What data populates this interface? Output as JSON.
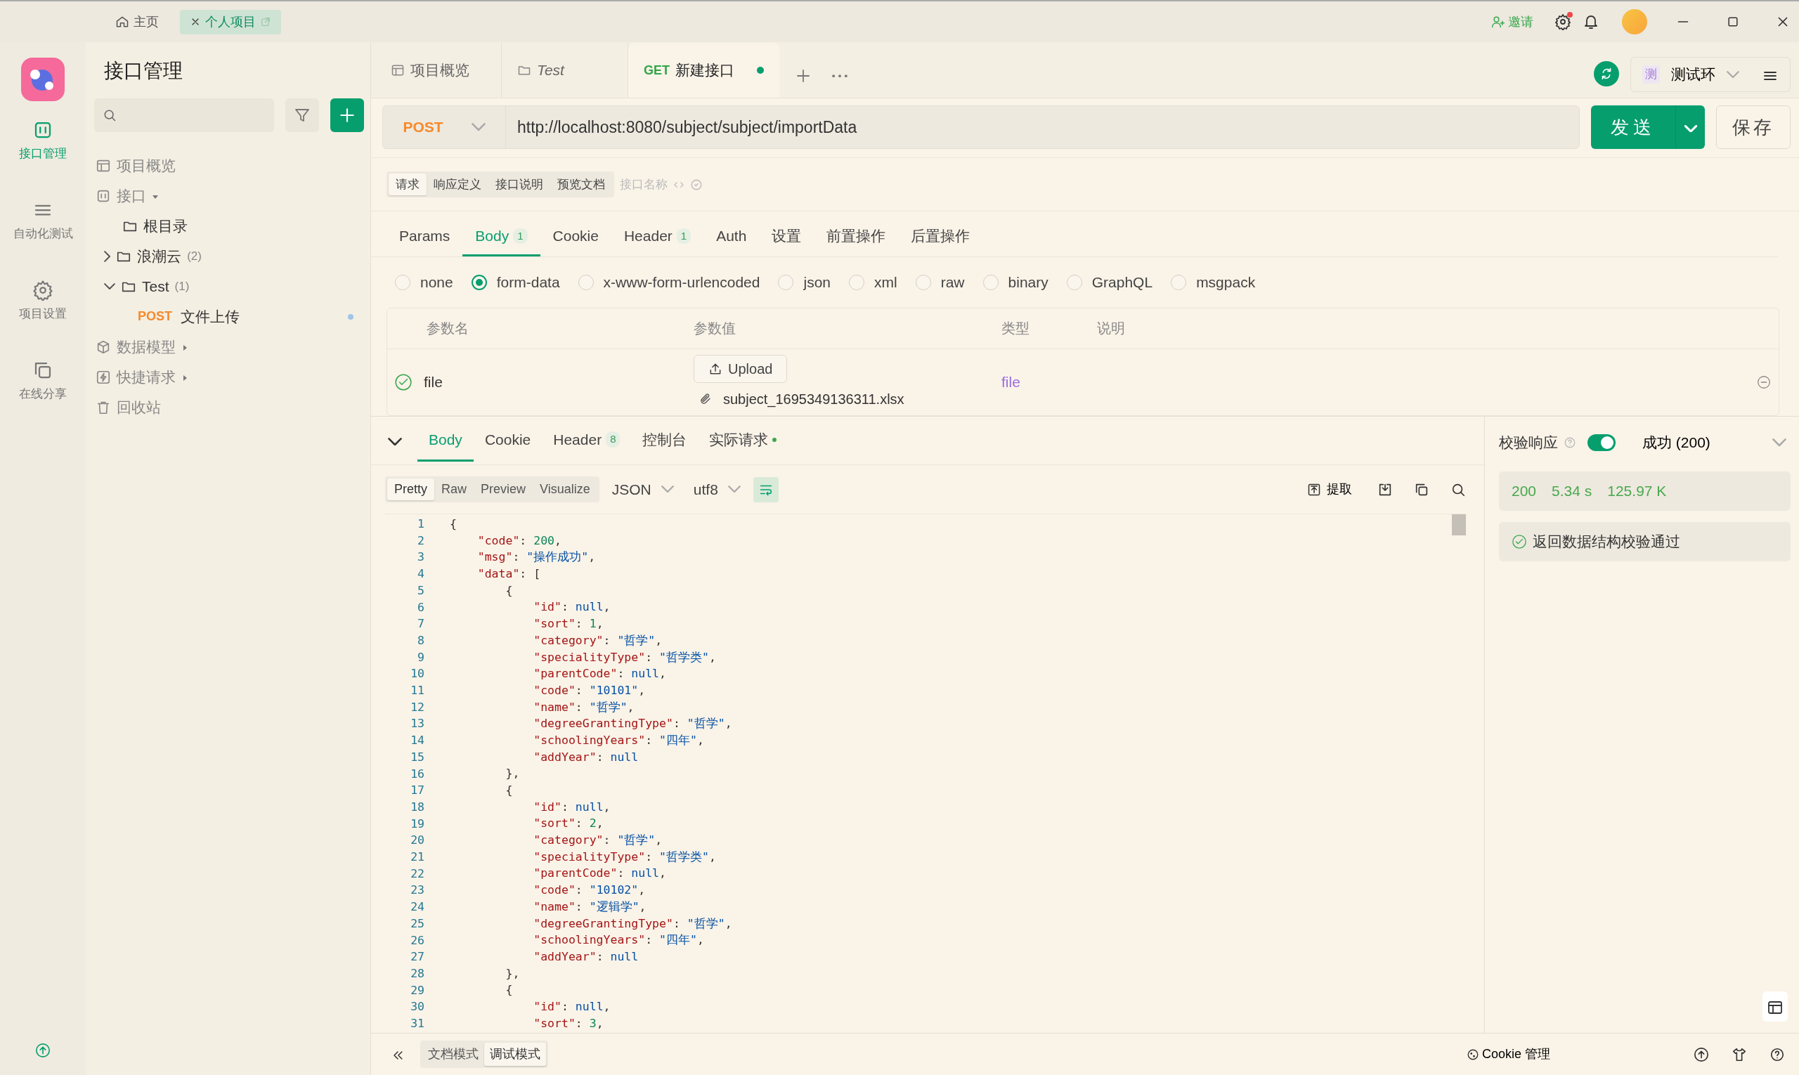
{
  "titlebar": {
    "tabs": [
      {
        "label": "主页",
        "kind": "home",
        "selected": false
      },
      {
        "label": "个人项目",
        "kind": "project",
        "selected": true
      }
    ],
    "invite": "邀请",
    "settings_alert": true
  },
  "rail": [
    {
      "label": "接口管理",
      "kind": "api",
      "selected": true
    },
    {
      "label": "自动化测试",
      "kind": "auto",
      "selected": false
    },
    {
      "label": "项目设置",
      "kind": "settings",
      "selected": false
    },
    {
      "label": "在线分享",
      "kind": "share",
      "selected": false
    }
  ],
  "sidebar": {
    "title": "接口管理",
    "tree": [
      {
        "label": "项目概览",
        "kind": "overview"
      },
      {
        "label": "接口",
        "kind": "api",
        "expanded": true,
        "children": [
          {
            "label": "根目录",
            "kind": "folder"
          },
          {
            "label": "浪潮云",
            "kind": "folder",
            "count": "(2)",
            "expanded": false
          },
          {
            "label": "Test",
            "kind": "folder",
            "count": "(1)",
            "expanded": true,
            "children": [
              {
                "label": "文件上传",
                "kind": "request",
                "method": "POST",
                "dot": true
              }
            ]
          }
        ]
      },
      {
        "label": "数据模型",
        "kind": "model",
        "expanded": false
      },
      {
        "label": "快捷请求",
        "kind": "quick",
        "expanded": false
      },
      {
        "label": "回收站",
        "kind": "trash"
      }
    ]
  },
  "doc_tabs": [
    {
      "label": "项目概览",
      "kind": "overview",
      "selected": false
    },
    {
      "label": "Test",
      "kind": "folder",
      "selected": false
    },
    {
      "label": "新建接口",
      "kind": "request",
      "method": "GET",
      "unsaved": true,
      "selected": true
    }
  ],
  "env": {
    "badge": "测",
    "label": "测试环"
  },
  "request": {
    "method": "POST",
    "url": "http://localhost:8080/subject/subject/importData",
    "send": "发送",
    "save": "保存"
  },
  "mode_tabs": [
    {
      "label": "请求",
      "selected": true
    },
    {
      "label": "响应定义",
      "selected": false
    },
    {
      "label": "接口说明",
      "selected": false
    },
    {
      "label": "预览文档",
      "selected": false
    }
  ],
  "name_placeholder": "接口名称",
  "param_tabs": [
    {
      "label": "Params",
      "selected": false
    },
    {
      "label": "Body",
      "count": "1",
      "selected": true
    },
    {
      "label": "Cookie",
      "selected": false
    },
    {
      "label": "Header",
      "count": "1",
      "selected": false
    },
    {
      "label": "Auth",
      "selected": false
    },
    {
      "label": "设置",
      "selected": false
    },
    {
      "label": "前置操作",
      "selected": false
    },
    {
      "label": "后置操作",
      "selected": false
    }
  ],
  "body_types": [
    {
      "label": "none",
      "selected": false
    },
    {
      "label": "form-data",
      "selected": true
    },
    {
      "label": "x-www-form-urlencoded",
      "selected": false
    },
    {
      "label": "json",
      "selected": false
    },
    {
      "label": "xml",
      "selected": false
    },
    {
      "label": "raw",
      "selected": false
    },
    {
      "label": "binary",
      "selected": false
    },
    {
      "label": "GraphQL",
      "selected": false
    },
    {
      "label": "msgpack",
      "selected": false
    }
  ],
  "params_table": {
    "columns": [
      "参数名",
      "参数值",
      "类型",
      "说明"
    ],
    "rows": [
      {
        "enabled": true,
        "name": "file",
        "button": "Upload",
        "file": "subject_1695349136311.xlsx",
        "type": "file"
      }
    ]
  },
  "response": {
    "tabs": [
      {
        "label": "Body",
        "selected": true
      },
      {
        "label": "Cookie",
        "selected": false
      },
      {
        "label": "Header",
        "count": "8",
        "selected": false
      },
      {
        "label": "控制台",
        "selected": false
      },
      {
        "label": "实际请求",
        "dot": true,
        "selected": false
      }
    ],
    "views": [
      {
        "label": "Pretty",
        "selected": true
      },
      {
        "label": "Raw",
        "selected": false
      },
      {
        "label": "Preview",
        "selected": false
      },
      {
        "label": "Visualize",
        "selected": false
      }
    ],
    "line_numbers": [
      "1",
      "2",
      "3",
      "4",
      "5",
      "6",
      "7",
      "8",
      "9",
      "10",
      "11",
      "12",
      "13",
      "14",
      "15",
      "16",
      "17",
      "18",
      "19",
      "20",
      "21",
      "22",
      "23",
      "24",
      "25",
      "26",
      "27",
      "28",
      "29",
      "30",
      "31"
    ],
    "format": "JSON",
    "encoding": "utf8",
    "wrap": true,
    "extract": "提取",
    "code": [
      "{",
      "    \"code\": 200,",
      "    \"msg\": \"操作成功\",",
      "    \"data\": [",
      "        {",
      "            \"id\": null,",
      "            \"sort\": 1,",
      "            \"category\": \"哲学\",",
      "            \"specialityType\": \"哲学类\",",
      "            \"parentCode\": null,",
      "            \"code\": \"10101\",",
      "            \"name\": \"哲学\",",
      "            \"degreeGrantingType\": \"哲学\",",
      "            \"schoolingYears\": \"四年\",",
      "            \"addYear\": null",
      "        },",
      "        {",
      "            \"id\": null,",
      "            \"sort\": 2,",
      "            \"category\": \"哲学\",",
      "            \"specialityType\": \"哲学类\",",
      "            \"parentCode\": null,",
      "            \"code\": \"10102\",",
      "            \"name\": \"逻辑学\",",
      "            \"degreeGrantingType\": \"哲学\",",
      "            \"schoolingYears\": \"四年\",",
      "            \"addYear\": null",
      "        },",
      "        {",
      "            \"id\": null,",
      "            \"sort\": 3,"
    ]
  },
  "validation": {
    "label": "校验响应",
    "on": true,
    "result": "成功 (200)",
    "status": "200",
    "time": "5.34 s",
    "size": "125.97 K",
    "message": "返回数据结构校验通过"
  },
  "footer": {
    "modes": [
      {
        "label": "文档模式",
        "selected": false
      },
      {
        "label": "调试模式",
        "selected": true
      }
    ],
    "cookie": "Cookie 管理"
  }
}
